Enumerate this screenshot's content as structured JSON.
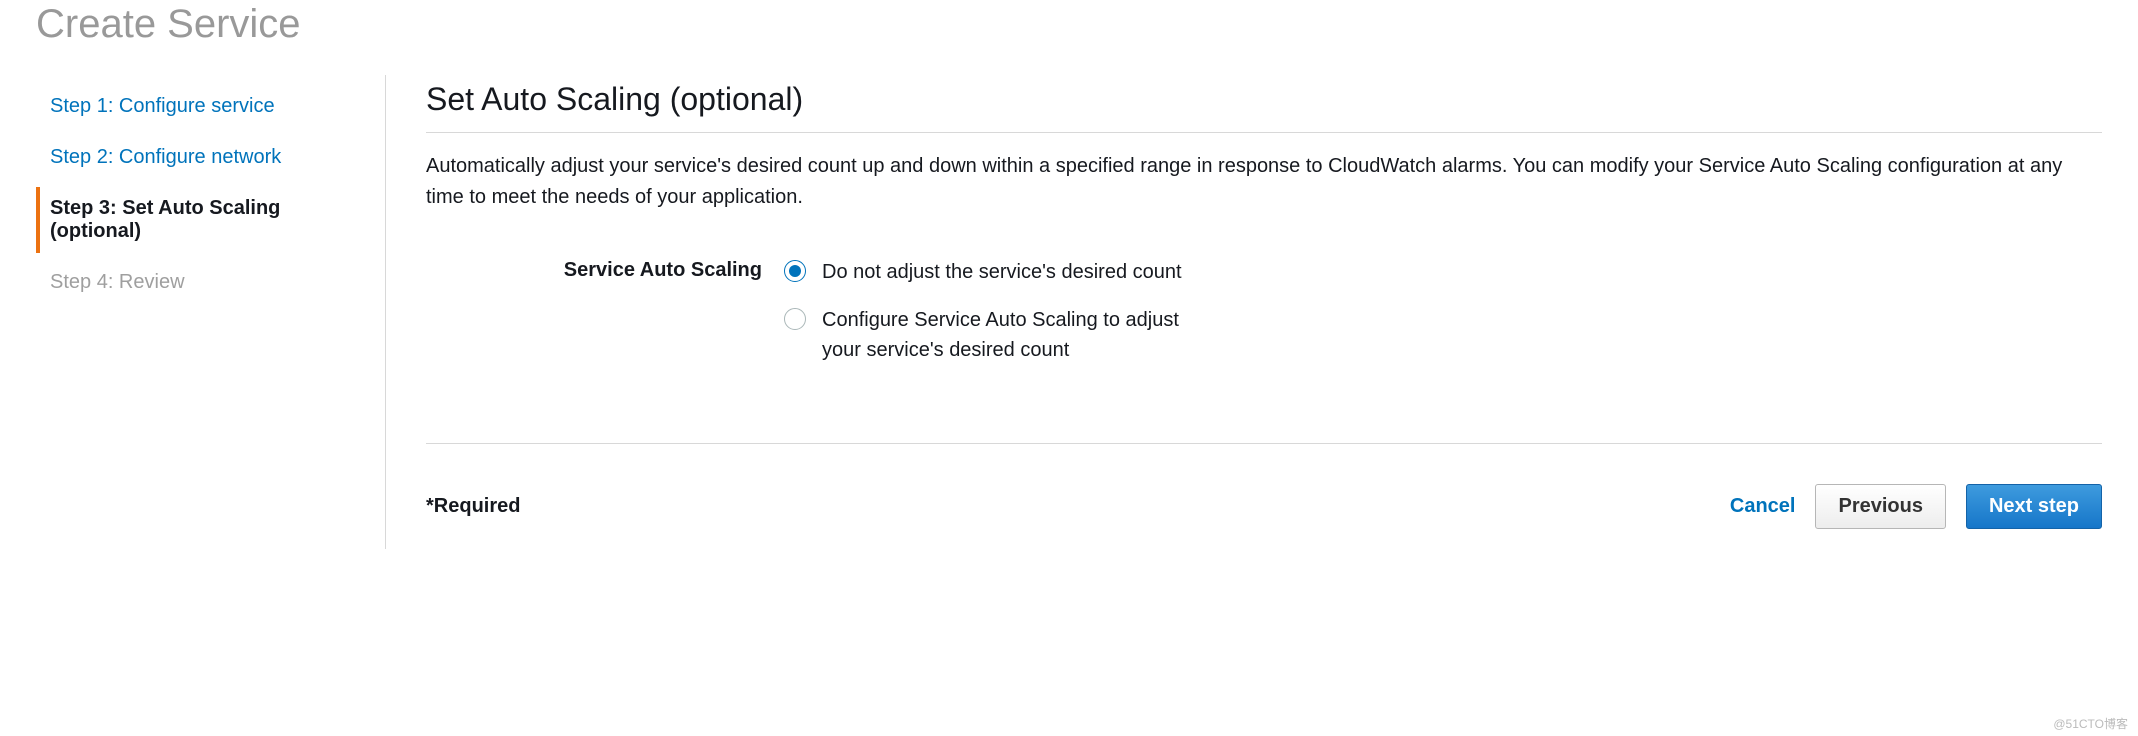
{
  "page_title": "Create Service",
  "sidebar": {
    "steps": [
      {
        "label": "Step 1: Configure service",
        "state": "link"
      },
      {
        "label": "Step 2: Configure network",
        "state": "link"
      },
      {
        "label": "Step 3: Set Auto Scaling (optional)",
        "state": "active"
      },
      {
        "label": "Step 4: Review",
        "state": "disabled"
      }
    ]
  },
  "main": {
    "section_title": "Set Auto Scaling (optional)",
    "section_desc": "Automatically adjust your service's desired count up and down within a specified range in response to CloudWatch alarms. You can modify your Service Auto Scaling configuration at any time to meet the needs of your application.",
    "form": {
      "label": "Service Auto Scaling",
      "options": [
        {
          "label": "Do not adjust the service's desired count",
          "selected": true
        },
        {
          "label": "Configure Service Auto Scaling to adjust your service's desired count",
          "selected": false
        }
      ]
    },
    "required_note": "*Required",
    "actions": {
      "cancel": "Cancel",
      "previous": "Previous",
      "next": "Next step"
    }
  },
  "watermark": "@51CTO博客"
}
